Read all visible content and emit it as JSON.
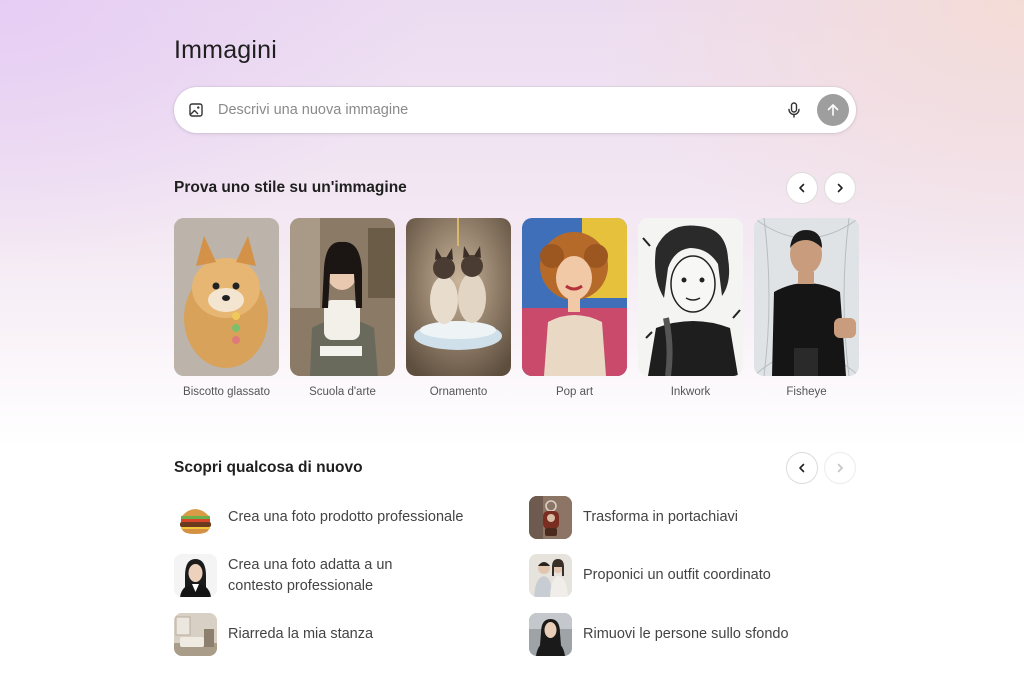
{
  "page": {
    "title": "Immagini"
  },
  "prompt": {
    "placeholder": "Descrivi una nuova immagine"
  },
  "icons": {
    "prompt_image": "image-icon",
    "mic": "microphone-icon",
    "send": "arrow-up-icon",
    "prev": "chevron-left-icon",
    "next": "chevron-right-icon"
  },
  "styles_section": {
    "title": "Prova uno stile su un'immagine",
    "cards": [
      {
        "label": "Biscotto glassato"
      },
      {
        "label": "Scuola d'arte"
      },
      {
        "label": "Ornamento"
      },
      {
        "label": "Pop art"
      },
      {
        "label": "Inkwork"
      },
      {
        "label": "Fisheye"
      }
    ]
  },
  "discover_section": {
    "title": "Scopri qualcosa di nuovo",
    "items": [
      {
        "label": "Crea una foto prodotto professionale"
      },
      {
        "label": "Trasforma in portachiavi"
      },
      {
        "label_line1": "Crea una foto adatta a un",
        "label_line2": "contesto professionale"
      },
      {
        "label": "Proponici un outfit coordinato"
      },
      {
        "label": "Riarreda la mia stanza"
      },
      {
        "label": "Rimuovi le persone sullo sfondo"
      }
    ]
  },
  "colors": {
    "send_button": "#9e9e9e",
    "accent_text": "#1f1f1f"
  }
}
